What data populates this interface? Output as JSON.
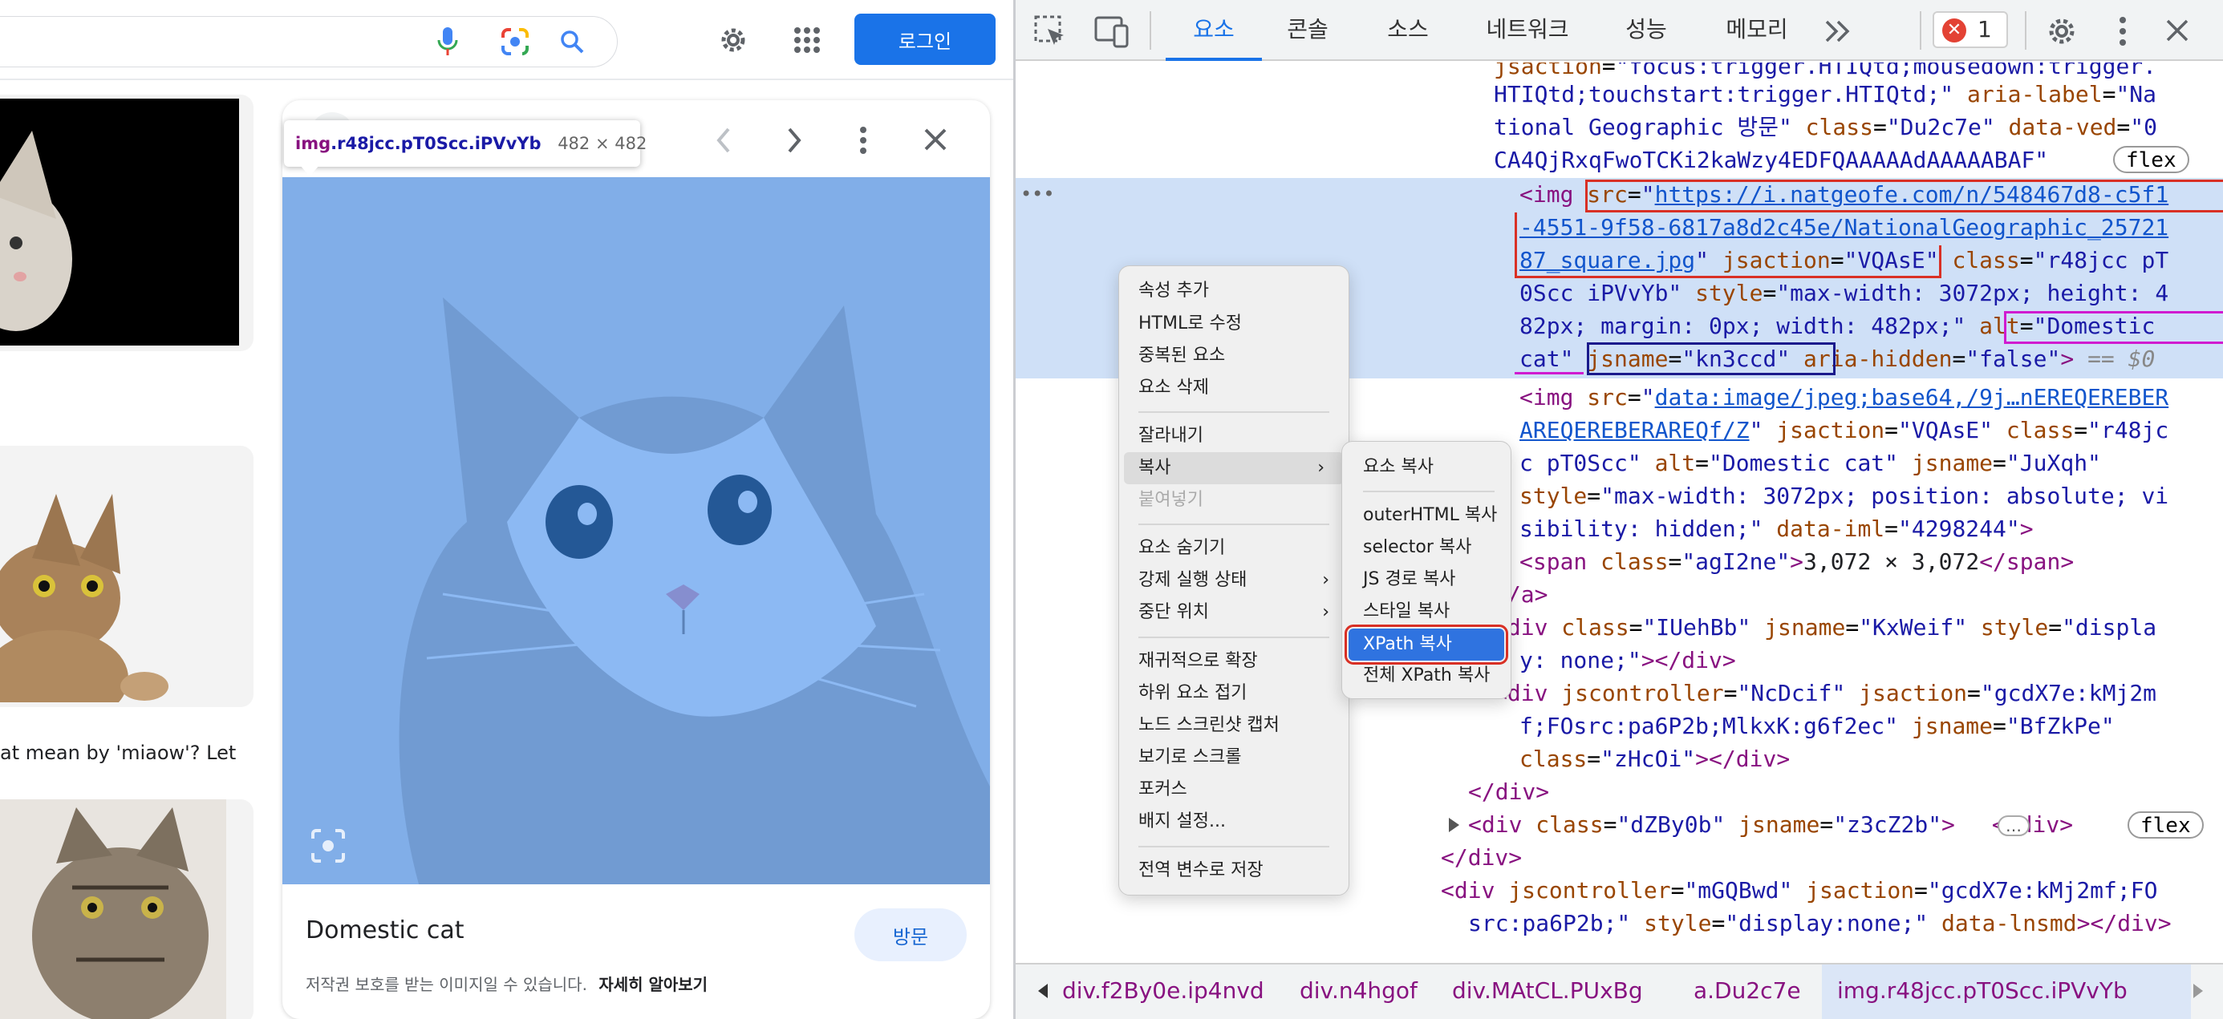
{
  "google": {
    "login_label": "로그인"
  },
  "results": {
    "snippet": "at mean by 'miaow'? Let ..."
  },
  "tooltip": {
    "selector_tag": "img",
    "selector_class": ".r48jcc.pT0Scc.iPVvYb",
    "size": "482 × 482"
  },
  "preview": {
    "title": "Domestic cat",
    "visit_label": "방문",
    "notice": "저작권 보호를 받는 이미지일 수 있습니다.",
    "learn_more": "자세히 알아보기"
  },
  "devtools": {
    "tabs": [
      "요소",
      "콘솔",
      "소스",
      "네트워크",
      "성능",
      "메모리"
    ],
    "error_count": "1",
    "breadcrumbs": [
      "div.f2By0e.ip4nvd",
      "div.n4hgof",
      "div.MAtCL.PUxBg",
      "a.Du2c7e",
      "img.r48jcc.pT0Scc.iPVvYb"
    ],
    "badge_flex": "flex",
    "ellipsis": "…"
  },
  "context_menu": {
    "items": [
      "속성 추가",
      "HTML로 수정",
      "중복된 요소",
      "요소 삭제",
      "잘라내기",
      "복사",
      "붙여넣기",
      "요소 숨기기",
      "강제 실행 상태",
      "중단 위치",
      "재귀적으로 확장",
      "하위 요소 접기",
      "노드 스크린샷 캡처",
      "보기로 스크롤",
      "포커스",
      "배지 설정...",
      "전역 변수로 저장"
    ]
  },
  "copy_submenu": {
    "items": [
      "요소 복사",
      "outerHTML 복사",
      "selector 복사",
      "JS 경로 복사",
      "스타일 복사",
      "XPath 복사",
      "전체 XPath 복사"
    ]
  },
  "colors": {
    "accent": "#1a73e8",
    "highlight": "#1a73e8",
    "selection": "#cfe0f7",
    "box_red": "#d93025",
    "box_blue": "#1a1a8c",
    "box_magenta": "#d01bd0"
  }
}
